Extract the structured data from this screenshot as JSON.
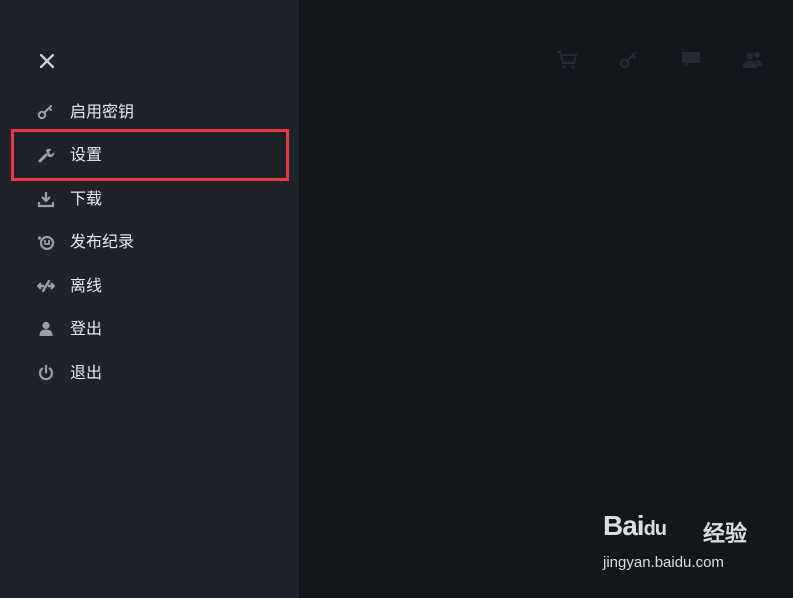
{
  "drawer": {
    "close_icon": "close-icon",
    "items": [
      {
        "icon": "key-icon",
        "label": "启用密钥"
      },
      {
        "icon": "wrench-icon",
        "label": "设置"
      },
      {
        "icon": "download-icon",
        "label": "下载"
      },
      {
        "icon": "release-notes-icon",
        "label": "发布纪录"
      },
      {
        "icon": "offline-icon",
        "label": "离线"
      },
      {
        "icon": "user-icon",
        "label": "登出"
      },
      {
        "icon": "power-icon",
        "label": "退出"
      }
    ],
    "highlighted_item": "设置"
  },
  "top_icons": [
    "cart-icon",
    "key-icon",
    "chat-icon",
    "friends-icon"
  ],
  "watermark": {
    "logo": "Bai",
    "logo_suffix": "du",
    "label": "经验",
    "url": "jingyan.baidu.com"
  },
  "colors": {
    "drawer_bg": "#1e222a",
    "overlay_bg": "#13161b",
    "highlight": "#e9393e",
    "text": "#e6e8eb"
  }
}
